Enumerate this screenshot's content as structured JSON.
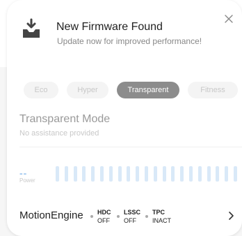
{
  "notification": {
    "title": "New Firmware Found",
    "subtitle": "Update now for improved performance!",
    "icon": "download-tray-icon",
    "close_icon": "close-icon"
  },
  "modes": {
    "tabs": [
      {
        "label": "Eco",
        "active": false
      },
      {
        "label": "Hyper",
        "active": false
      },
      {
        "label": "Transparent",
        "active": true
      },
      {
        "label": "Fitness",
        "active": false
      }
    ],
    "current_title": "Transparent Mode",
    "current_description": "No assistance provided"
  },
  "power": {
    "value": "--",
    "label": "Power",
    "bar_color": "#d9e9f8",
    "value_color": "#9cc6ef"
  },
  "motion_engine": {
    "label": "MotionEngine",
    "statuses": [
      {
        "name": "HDC",
        "value": "OFF"
      },
      {
        "name": "LSSC",
        "value": "OFF"
      },
      {
        "name": "TPC",
        "value": "INACT"
      }
    ]
  },
  "colors": {
    "active_tab": "#8c8c8c",
    "inactive_tab_text": "#c8c8c8"
  }
}
